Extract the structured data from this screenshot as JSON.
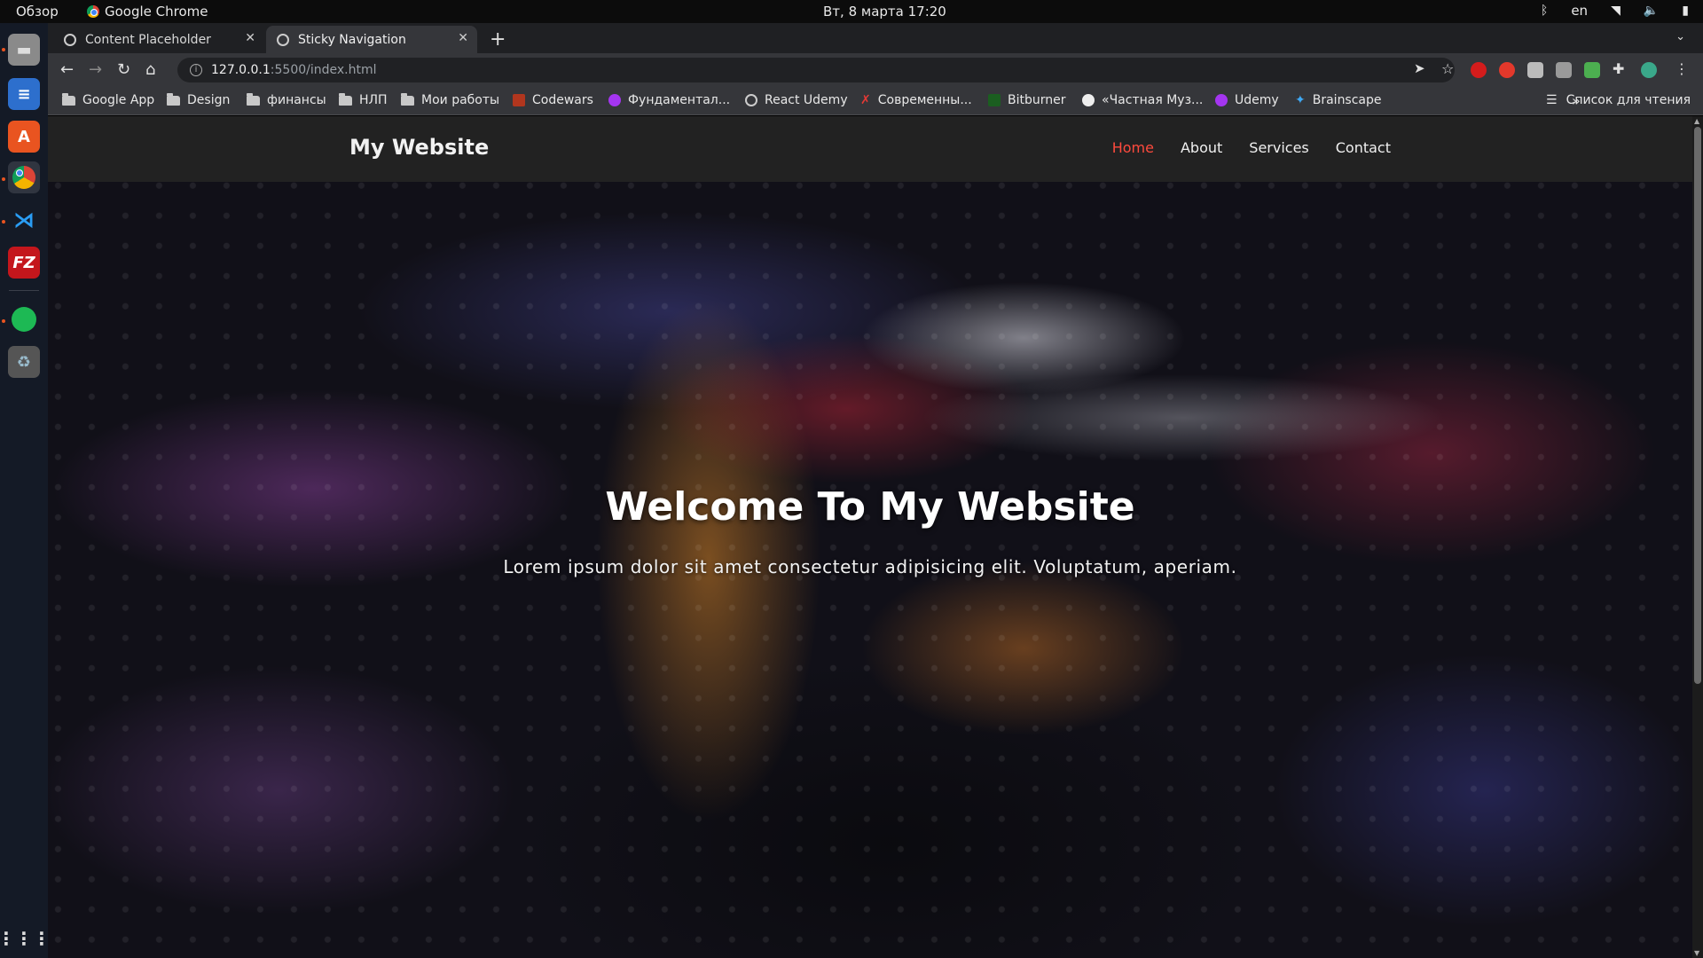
{
  "topbar": {
    "activities": "Обзор",
    "app_name": "Google Chrome",
    "clock": "Вт, 8 марта  17:20",
    "lang": "en"
  },
  "dock": {
    "icons": [
      "files-icon",
      "writer-icon",
      "software-center-icon",
      "chrome-icon",
      "vscode-icon",
      "filezilla-icon",
      "spotify-icon",
      "trash-icon",
      "show-apps-icon"
    ]
  },
  "tabs": [
    {
      "title": "Content Placeholder",
      "active": false
    },
    {
      "title": "Sticky Navigation",
      "active": true
    }
  ],
  "omnibox": {
    "host": "127.0.0.1",
    "path": ":5500/index.html"
  },
  "bookmarks": [
    {
      "label": "Google App",
      "icon": "folder-icon"
    },
    {
      "label": "Design",
      "icon": "folder-icon"
    },
    {
      "label": "финансы",
      "icon": "folder-icon"
    },
    {
      "label": "НЛП",
      "icon": "folder-icon"
    },
    {
      "label": "Мои работы",
      "icon": "folder-icon"
    },
    {
      "label": "Codewars",
      "icon": "codewars-icon"
    },
    {
      "label": "Фундаментал...",
      "icon": "udemy-icon"
    },
    {
      "label": "React Udemy",
      "icon": "globe-icon"
    },
    {
      "label": "Современны...",
      "icon": "x-icon"
    },
    {
      "label": "Bitburner",
      "icon": "bitburner-icon"
    },
    {
      "label": "«Частная Муз...",
      "icon": "music-icon"
    },
    {
      "label": "Udemy",
      "icon": "udemy-icon"
    },
    {
      "label": "Brainscape",
      "icon": "brainscape-icon"
    }
  ],
  "bookmarks_more": "»",
  "reading_list": "Список для чтения",
  "site": {
    "logo": "My Website",
    "menu": [
      {
        "label": "Home",
        "active": true
      },
      {
        "label": "About",
        "active": false
      },
      {
        "label": "Services",
        "active": false
      },
      {
        "label": "Contact",
        "active": false
      }
    ],
    "hero_title": "Welcome To My Website",
    "hero_subtitle": "Lorem ipsum dolor sit amet consectetur adipisicing elit. Voluptatum, aperiam."
  },
  "colors": {
    "nav_bg": "#222222",
    "active_link": "#ff4a3d",
    "chrome_toolbar": "#35363a",
    "tabstrip": "#1f2023"
  }
}
